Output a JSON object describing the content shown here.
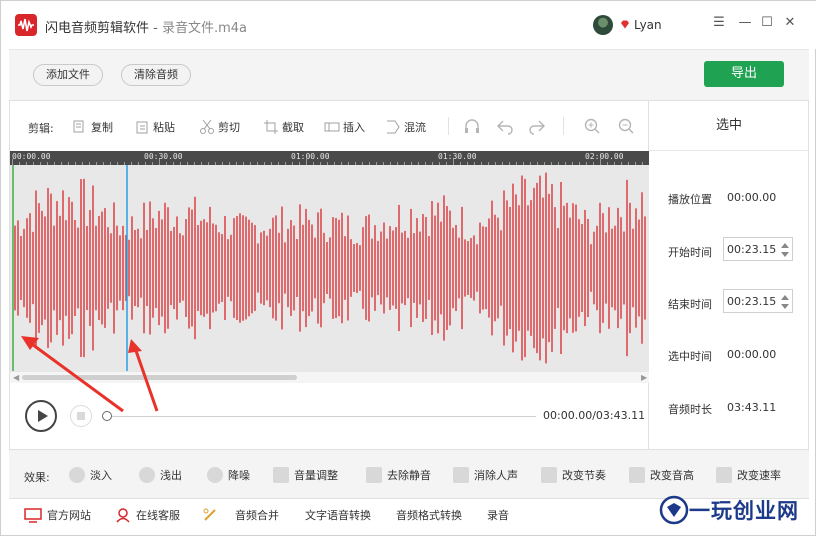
{
  "window": {
    "app_title": "闪电音频剪辑软件",
    "separator": " - ",
    "file_name": "录音文件.m4a",
    "user_name": "Lyan",
    "controls": {
      "menu": "☰",
      "minimize": "—",
      "maximize": "☐",
      "close": "✕"
    }
  },
  "actions": {
    "add_file": "添加文件",
    "clear_audio": "清除音频",
    "export": "导出"
  },
  "toolbar": {
    "label": "剪辑:",
    "items": [
      "复制",
      "粘贴",
      "剪切",
      "截取",
      "插入",
      "混流"
    ]
  },
  "ruler": {
    "labels": [
      "00:00.00",
      "00:30.00",
      "01:00.00",
      "01:30.00",
      "02:00.00"
    ]
  },
  "player": {
    "time": "00:00.00/03:43.11",
    "progress": 0
  },
  "selection_panel": {
    "title": "选中",
    "play_position_label": "播放位置",
    "play_position": "00:00.00",
    "start_label": "开始时间",
    "start": "00:23.15",
    "end_label": "结束时间",
    "end": "00:23.15",
    "selected_label": "选中时间",
    "selected": "00:00.00",
    "duration_label": "音频时长",
    "duration": "03:43.11"
  },
  "effects": {
    "label": "效果:",
    "items": [
      "淡入",
      "浅出",
      "降噪",
      "音量调整",
      "去除静音",
      "消除人声",
      "改变节奏",
      "改变音高",
      "改变速率"
    ]
  },
  "footer": {
    "items": [
      "官方网站",
      "在线客服",
      "音频合并",
      "文字语音转换",
      "音频格式转换",
      "录音"
    ]
  },
  "watermark": "一玩创业网",
  "colors": {
    "accent": "#1fa251",
    "waveform": "#d8262b",
    "playhead": "#2aa0e0",
    "marker": "#3cb043",
    "annotation": "#e8322a"
  }
}
